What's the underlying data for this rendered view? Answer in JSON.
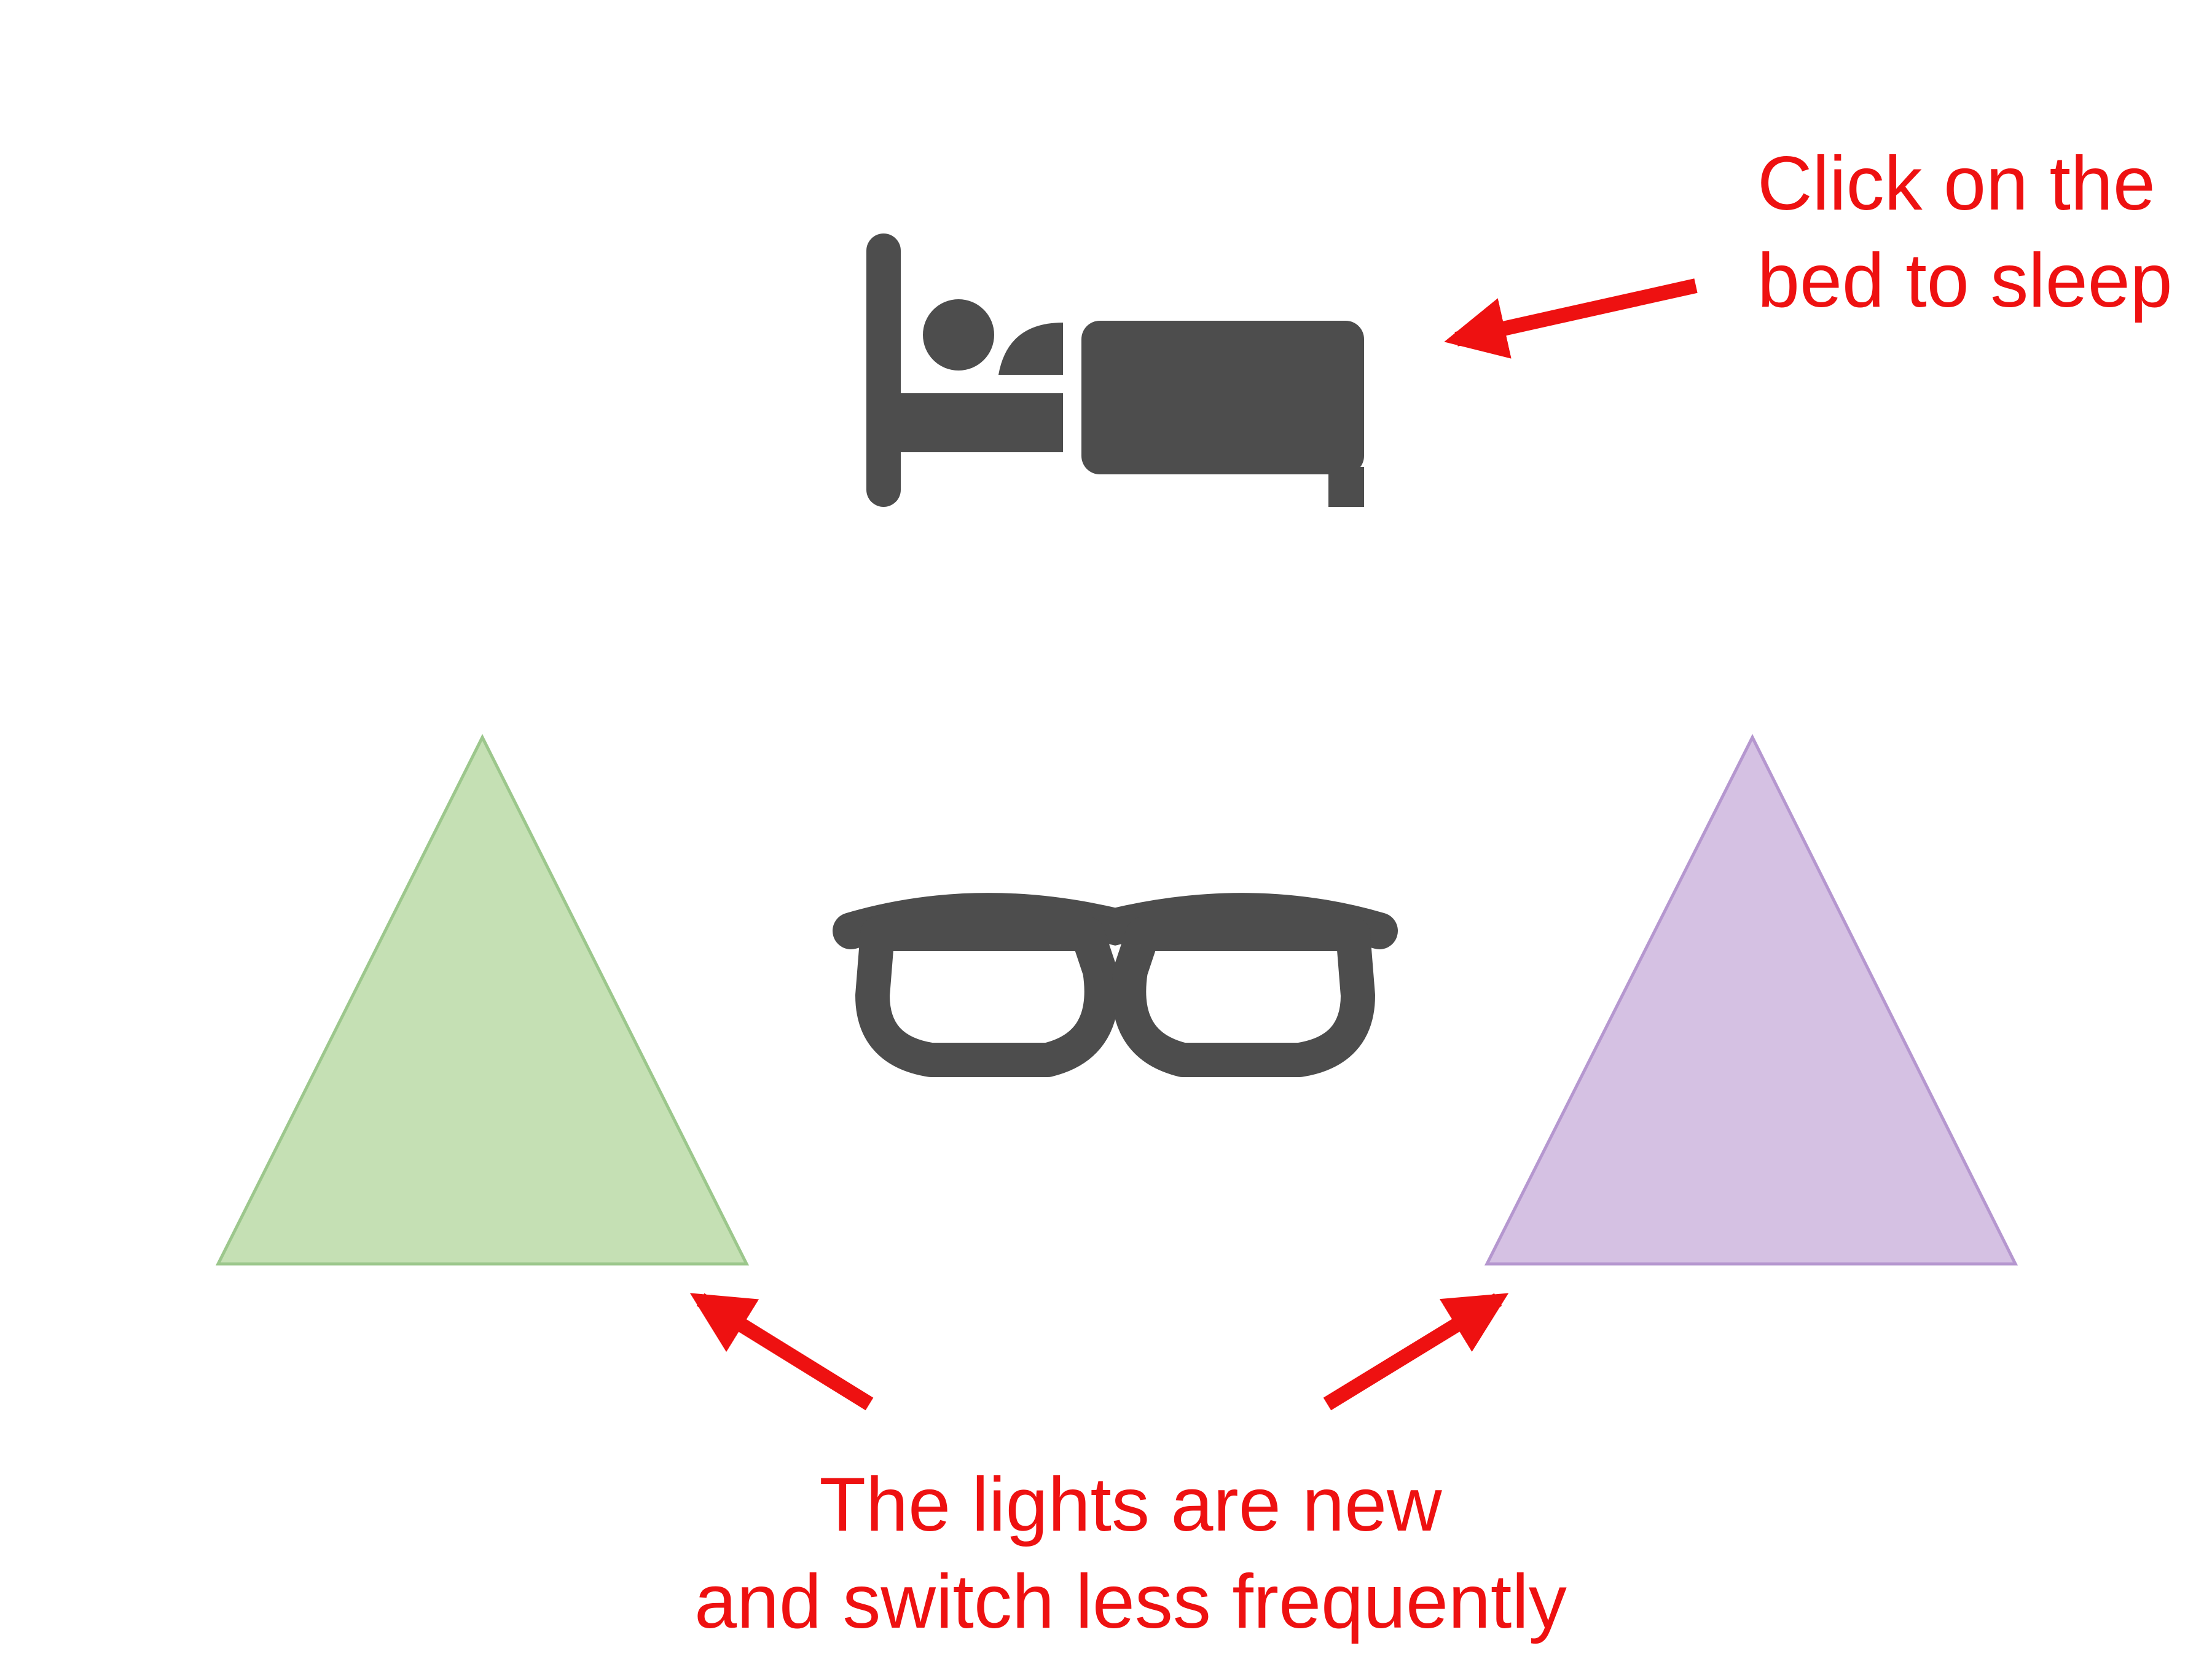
{
  "colors": {
    "annotation": "#ee1111",
    "icon": "#4d4d4d",
    "green_light_fill": "#c5e0b4",
    "green_light_stroke": "#9cc78c",
    "purple_light_fill": "#d5c1e3",
    "purple_light_stroke": "#b597cf",
    "background": "#ffffff"
  },
  "icons": {
    "bed": "bed-icon",
    "glasses": "glasses-icon"
  },
  "bed_annotation": {
    "line1": "Click on the",
    "line2": "bed to sleep"
  },
  "lights_annotation": {
    "line1": "The lights are new",
    "line2": "and switch less frequently"
  }
}
